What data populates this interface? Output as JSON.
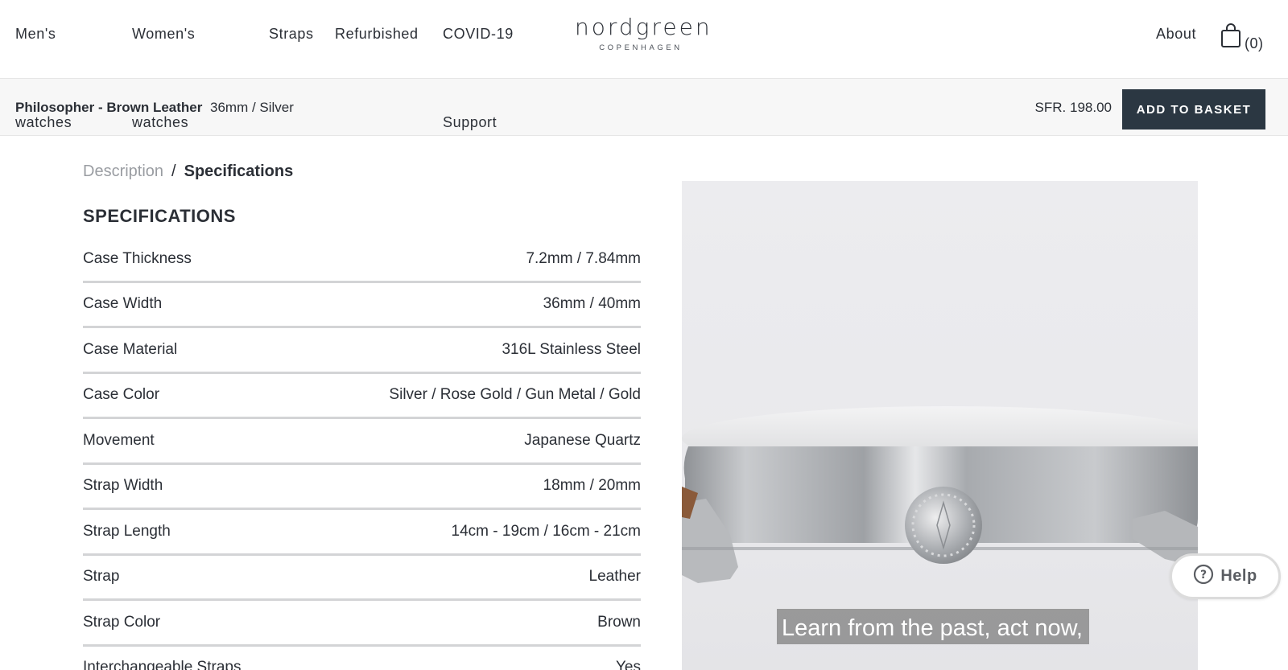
{
  "nav": {
    "mens": "Men's",
    "mens_sub": "watches",
    "womens": "Women's",
    "womens_sub": "watches",
    "straps": "Straps",
    "refurbished": "Refurbished",
    "covid": "COVID-19",
    "covid_sub": "Support",
    "about": "About",
    "cart_count": "(0)"
  },
  "logo": {
    "name": "nordgreen",
    "tagline": "COPENHAGEN"
  },
  "product_bar": {
    "name": "Philosopher - Brown Leather",
    "variant": "36mm / Silver",
    "price": "SFR. 198.00",
    "button_label": "ADD TO BASKET"
  },
  "tabs": {
    "description": "Description",
    "separator": "/",
    "specifications": "Specifications"
  },
  "spec_title": "SPECIFICATIONS",
  "specs": [
    {
      "label": "Case Thickness",
      "value": "7.2mm / 7.84mm"
    },
    {
      "label": "Case Width",
      "value": "36mm / 40mm"
    },
    {
      "label": "Case Material",
      "value": "316L Stainless Steel"
    },
    {
      "label": "Case Color",
      "value": "Silver / Rose Gold / Gun Metal / Gold"
    },
    {
      "label": "Movement",
      "value": "Japanese Quartz"
    },
    {
      "label": "Strap Width",
      "value": "18mm / 20mm"
    },
    {
      "label": "Strap Length",
      "value": "14cm - 19cm / 16cm - 21cm"
    },
    {
      "label": "Strap",
      "value": "Leather"
    },
    {
      "label": "Strap Color",
      "value": "Brown"
    },
    {
      "label": "Interchangeable Straps",
      "value": "Yes"
    }
  ],
  "image": {
    "caption": "Learn from the past, act now,"
  },
  "help": {
    "label": "Help",
    "icon": "question-circle-icon"
  },
  "colors": {
    "button_bg": "#2b3742",
    "text": "#2b2f36",
    "muted": "#9a9da2",
    "divider": "#d3d4d6"
  }
}
